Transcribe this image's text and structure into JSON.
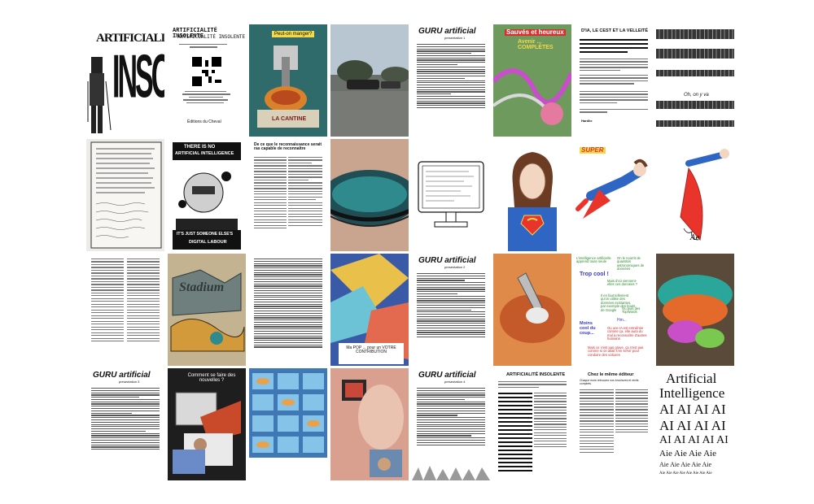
{
  "tiles": {
    "t1": {
      "title": "ARTIFICIALITÉ",
      "title2": "INSOLENTE"
    },
    "t2": {
      "title": "ARTIFICIALITÉ INSOLENTE",
      "subtitle": "ARTIFICIALITÉ INSOLENTE",
      "footer": "Éditions du Cheval"
    },
    "t3": {
      "top_label": "Peut-on manger?",
      "bottom_label": "LA CANTINE"
    },
    "t4": {},
    "t5": {
      "header": "GURU artificial",
      "header_sub": "presentation 1"
    },
    "t6": {
      "title": "Sauvés et heureux",
      "title2": "Avenir ... COMPLÈTES"
    },
    "t7": {
      "title": "D'IA, LE CEST ET LA VELLEITÉ",
      "footer": "Hardlie"
    },
    "t8": {
      "note": "Oh, on y va"
    },
    "t10": {
      "line1": "THERE IS NO",
      "line2": "ARTIFICIAL INTELLIGENCE",
      "line3": "IT'S JUST SOMEONE ELSE'S",
      "line4": "DIGITAL LABOUR"
    },
    "t11": {
      "title": "De ce que le reconnaissance serait ras capable de reconnaître"
    },
    "t16": {
      "logo": "SUPER"
    },
    "t18": {
      "sign": "Ae"
    },
    "t21": {
      "title": "Stadium"
    },
    "t22": {},
    "t23": {
      "caption": "Ma POP ... pour un VOTRE CONTRIBUTION"
    },
    "t25": {
      "header": "GURU artificial",
      "header_sub": "presentation 2"
    },
    "t26": {},
    "t27": {
      "n1": "L'intelligence artificielle apprend toute seule",
      "n2": "On le nourrit de quantités astronomiques de données",
      "n3": "Trop cool !",
      "n4": "Mais d'où viennent-elles ces données ?",
      "n5": "Il en faut tellement qu'on utilise des données existantes, par exemple des bouts de Google",
      "n6": "Ou puis des TopWards",
      "n7": "Hm...",
      "n8": "Moins cool du coup...",
      "n9": "Ou une IA est entraînée comme ça, elle aura du mal à reconnaître d'autres humains",
      "n10": "Mais ce n'est pas grave, ça n'est pas comme si on allait s'en servir pour conduire des voitures"
    },
    "t29": {
      "header": "GURU artificial",
      "header_sub": "presentation 3"
    },
    "t30": {
      "title": "Comment se faire des nouvelles ?"
    },
    "t33": {
      "header": "GURU artificial",
      "header_sub": "presentation 4"
    },
    "t34": {
      "title": "ARTIFICIALITÉ INSOLENTE"
    },
    "t35": {
      "title": "Chez le même éditeur",
      "subtitle": "Chaque mois retrouvez nos brochures et récits complets."
    },
    "t36": {},
    "t37": {
      "line1": "Artificial",
      "line2": "Intelligence",
      "line3": "AI AI AI AI",
      "line4": "AI AI AI AI",
      "line5": "AI AI AI AI AI",
      "line6": "Aie Aie Aie Aie",
      "line7": "Aie Aie Aie Aie Aie",
      "line8": "Aie Aie Aie Aie Aie Aie Aie Aie"
    }
  },
  "colors": {
    "bg": "#ffffff",
    "ink": "#111111",
    "blue_note": "#3a3acc",
    "green_note": "#2b8a2b",
    "red_note": "#cc2b2b"
  }
}
